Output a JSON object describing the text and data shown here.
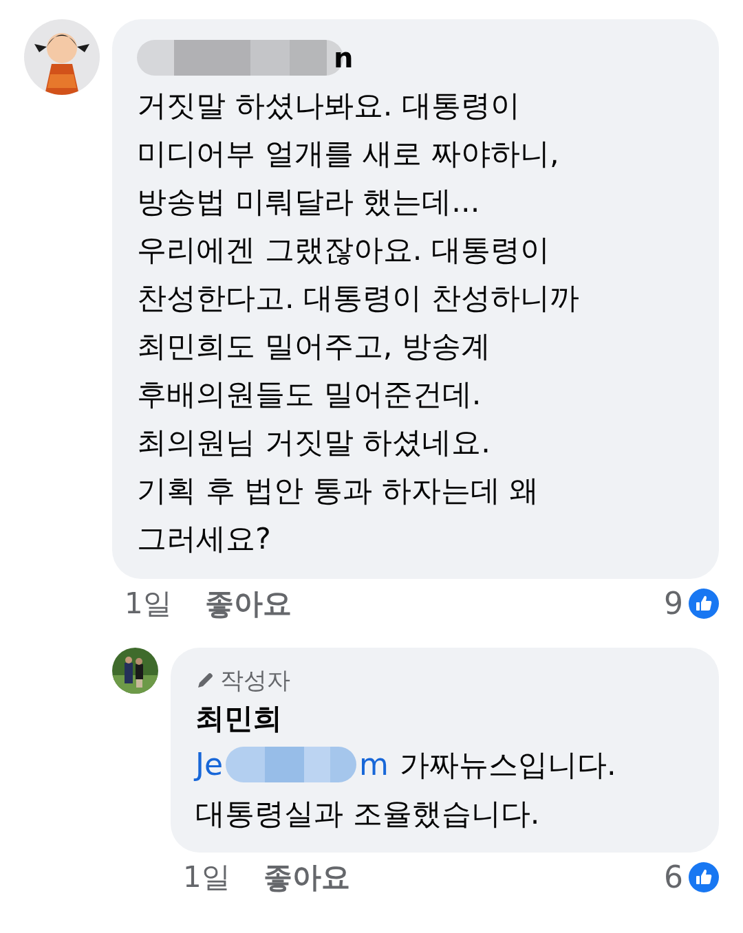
{
  "comments": [
    {
      "kind": "comment",
      "author_tail": "n",
      "lines": [
        "거짓말 하셨나봐요. 대통령이",
        "미디어부 얼개를 새로 짜야하니,",
        "방송법 미뤄달라 했는데...",
        "우리에겐 그랬잖아요. 대통령이",
        "찬성한다고. 대통령이 찬성하니까",
        "최민희도 밀어주고, 방송계",
        "후배의원들도 밀어준건데.",
        "최의원님 거짓말 하셨네요.",
        "기획 후 법안 통과 하자는데 왜",
        "그러세요?"
      ],
      "time": "1일",
      "like_label": "좋아요",
      "like_count": "9"
    },
    {
      "kind": "reply",
      "badge": "작성자",
      "author": "최민희",
      "mention_head": "Je",
      "mention_tail": "m",
      "lines": [
        "가짜뉴스입니다.",
        "대통령실과 조율했습니다."
      ],
      "time": "1일",
      "like_label": "좋아요",
      "like_count": "6"
    }
  ]
}
